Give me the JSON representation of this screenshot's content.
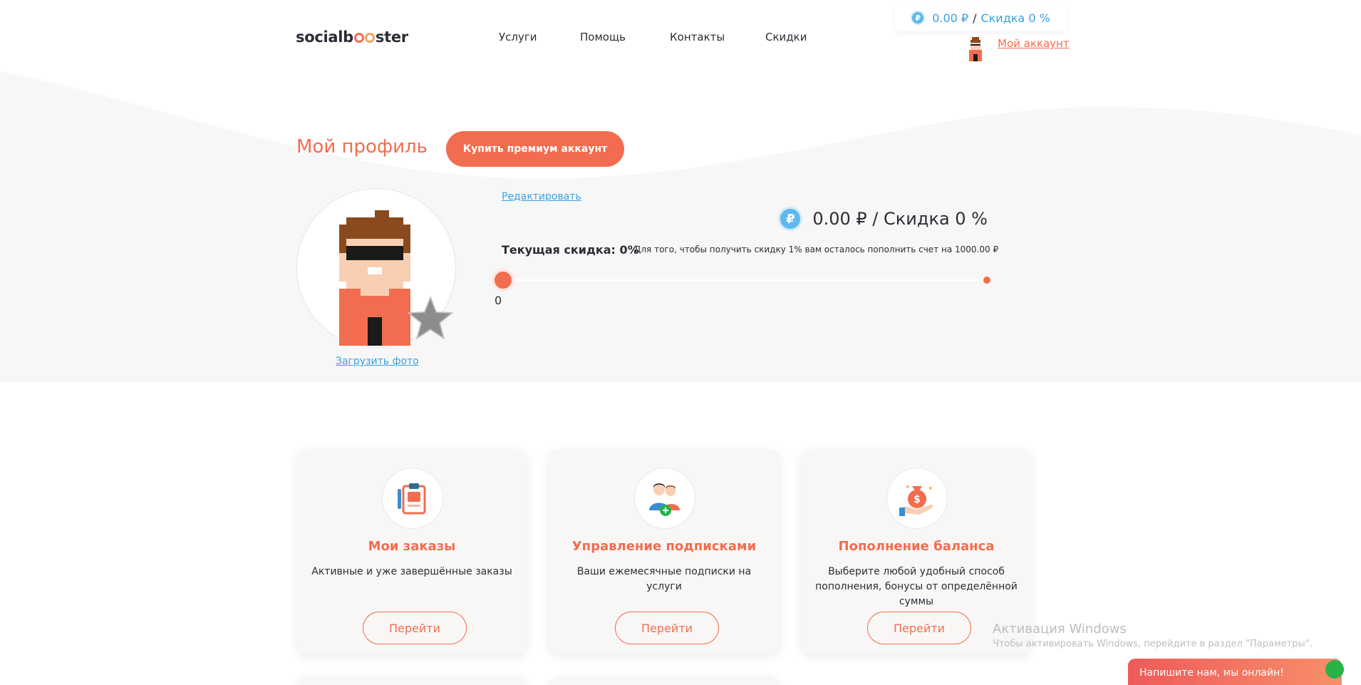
{
  "header": {
    "logo": {
      "part1": "socialb",
      "part2": "ster"
    },
    "nav": [
      "Услуги",
      "Помощь",
      "Контакты",
      "Скидки"
    ],
    "balance_widget": {
      "coin_symbol": "₽",
      "amount": "0.00 ₽",
      "separator": "/",
      "discount": "Скидка 0 %"
    },
    "account_link": "Мой аккаунт"
  },
  "profile": {
    "title": "Мой профиль",
    "premium_button": "Купить премиум аккаунт",
    "upload_photo": "Загрузить фото",
    "edit": "Редактировать",
    "balance": {
      "coin_symbol": "₽",
      "text": "0.00 ₽ / Скидка 0 %"
    },
    "current_discount": "Текущая скидка: 0%",
    "discount_hint": "Для того, чтобы получить скидку 1% вам осталось пополнить счет на 1000.00 ₽",
    "slider": {
      "value": "0",
      "fraction": 0
    }
  },
  "cards": [
    {
      "title": "Мои заказы",
      "description": "Активные и уже завершённые заказы",
      "button": "Перейти",
      "icon": "clipboard-icon"
    },
    {
      "title": "Управление подписками",
      "description": "Ваши ежемесячные подписки на услуги",
      "button": "Перейти",
      "icon": "users-add-icon"
    },
    {
      "title": "Пополнение баланса",
      "description": "Выберите любой удобный способ пополнения, бонусы от определённой суммы",
      "button": "Перейти",
      "icon": "money-bag-icon"
    }
  ],
  "windows_watermark": {
    "title": "Активация Windows",
    "subtitle": "Чтобы активировать Windows, перейдите в раздел \"Параметры\"."
  },
  "chat": {
    "label": "Напишите нам, мы онлайн!"
  },
  "colors": {
    "accent": "#f26d4f",
    "link": "#3aa0dd",
    "background_band": "#f7f7f7"
  }
}
